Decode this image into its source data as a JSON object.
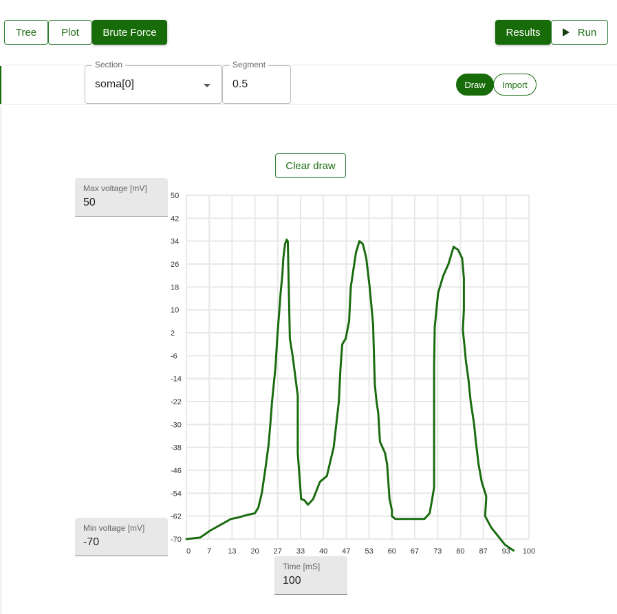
{
  "nav": {
    "tree_label": "Tree",
    "plot_label": "Plot",
    "brute_force_label": "Brute Force",
    "results_label": "Results",
    "run_label": "Run"
  },
  "toolbar": {
    "section_legend": "Section",
    "section_value": "soma[0]",
    "segment_legend": "Segment",
    "segment_value": "0.5",
    "draw_label": "Draw",
    "import_label": "Import"
  },
  "canvas": {
    "clear_label": "Clear draw",
    "max_voltage_label": "Max voltage [mV]",
    "max_voltage_value": "50",
    "min_voltage_label": "Min voltage [mV]",
    "min_voltage_value": "-70",
    "time_label": "Time [mS]",
    "time_value": "100"
  },
  "colors": {
    "accent": "#176b08",
    "line": "#1a6b10",
    "grid": "#e8e8e8"
  },
  "icons": {
    "dropdown": "caret-down-icon",
    "run": "play-icon"
  },
  "chart_data": {
    "type": "line",
    "x_ticks": [
      "0",
      "7",
      "13",
      "20",
      "27",
      "33",
      "40",
      "47",
      "53",
      "60",
      "67",
      "73",
      "80",
      "87",
      "93",
      "100"
    ],
    "y_ticks": [
      "50",
      "42",
      "34",
      "26",
      "18",
      "10",
      "2",
      "-6",
      "-14",
      "-22",
      "-30",
      "-38",
      "-46",
      "-54",
      "-62",
      "-70"
    ],
    "xlim": [
      0,
      100
    ],
    "ylim": [
      -70,
      50
    ],
    "grid": true,
    "series": [
      {
        "x": [
          0,
          4,
          7,
          10,
          13,
          15,
          18,
          20,
          21,
          22,
          23,
          24,
          24.5,
          25,
          26,
          26.5,
          27,
          27.5,
          28,
          28.3,
          28.8,
          29.3,
          29.6,
          30.2,
          31,
          32.5,
          32.5,
          33.5,
          34.5,
          35.5,
          35.5,
          37,
          39,
          41,
          43,
          44.5,
          45,
          45.5,
          46.5,
          47.5,
          48,
          49,
          49.5,
          50.5,
          51.5,
          52.5,
          53.5,
          54.5,
          55,
          55.5,
          56,
          56.5,
          58,
          58.6,
          59.3,
          60,
          60,
          61,
          64,
          67,
          69.5,
          71,
          71.6,
          72.3,
          72.3,
          72.5,
          73.5,
          75,
          76.5,
          78,
          79.3,
          80.5,
          81,
          81,
          80.7,
          81.3,
          81.6,
          82.3,
          83,
          84,
          84.5,
          85.3,
          86.2,
          87.5,
          87.5,
          87.2,
          89,
          91,
          93,
          95.5
        ],
        "y": [
          -70,
          -69.5,
          -67,
          -65,
          -63,
          -62.5,
          -61.5,
          -61,
          -59,
          -54,
          -46,
          -37,
          -30,
          -22,
          -10,
          0,
          8,
          16,
          22,
          28,
          33,
          34.5,
          34,
          0,
          -6,
          -20,
          -40,
          -56,
          -56.5,
          -58,
          -58,
          -56,
          -50,
          -48,
          -38,
          -22,
          -10,
          -2,
          0,
          6,
          18,
          26,
          30,
          34,
          33,
          28,
          18,
          5,
          -16,
          -22,
          -26,
          -36,
          -40,
          -44,
          -56,
          -60,
          -62,
          -63,
          -63,
          -63,
          -63,
          -61,
          -57,
          -52,
          -10,
          4,
          16,
          22,
          26,
          32,
          31,
          28,
          21,
          10,
          3,
          -4,
          -8,
          -14,
          -22,
          -30,
          -36,
          -44,
          -50,
          -55,
          -56,
          -62,
          -66,
          -69,
          -72,
          -74
        ]
      }
    ]
  }
}
